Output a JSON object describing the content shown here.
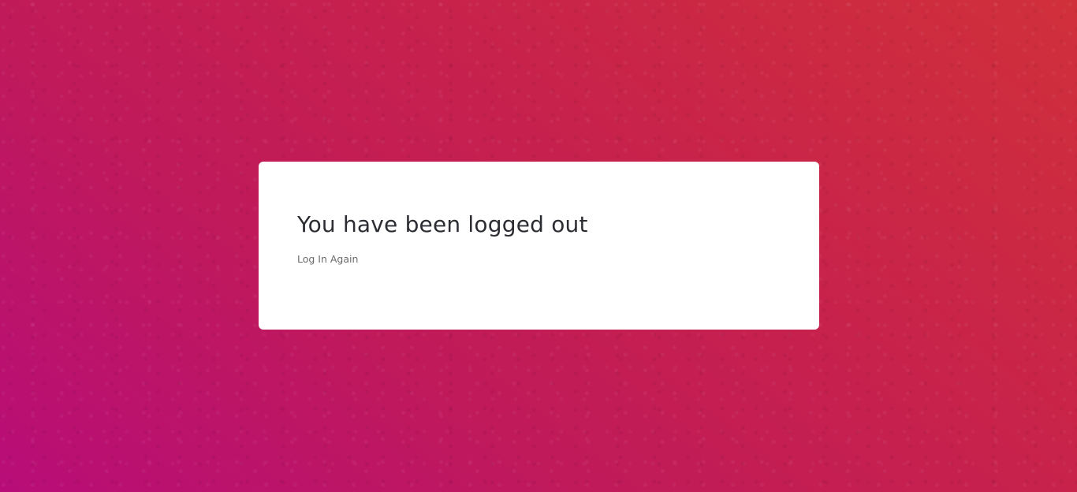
{
  "page": {
    "background_colors": [
      "#b80d78",
      "#c8234a",
      "#d0303a"
    ]
  },
  "card": {
    "title": "You have been logged out",
    "login_link": "Log In Again"
  }
}
